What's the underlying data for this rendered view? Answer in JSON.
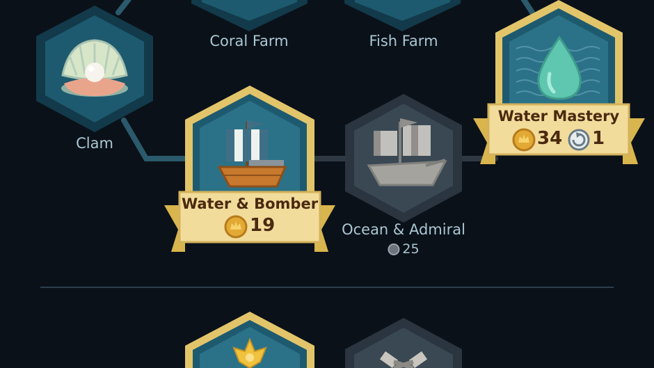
{
  "tree": {
    "top_row": {
      "coral_farm": {
        "label": "Coral Farm"
      },
      "fish_farm": {
        "label": "Fish Farm"
      }
    },
    "clam": {
      "label": "Clam",
      "icon": "clam-pearl-icon"
    },
    "water_mastery": {
      "label": "Water Mastery",
      "coin_cost": "34",
      "turns": "1",
      "icon": "water-drop-icon",
      "state": "available"
    },
    "water_bomber": {
      "label": "Water & Bomber",
      "coin_cost": "19",
      "icon": "sailing-ship-icon",
      "state": "available"
    },
    "ocean_admiral": {
      "label": "Ocean & Admiral",
      "coin_cost": "25",
      "icon": "galleon-icon",
      "state": "locked"
    },
    "next_row": {
      "left_icon": "golden-crown-icon",
      "right_icon": "crossed-tools-icon"
    }
  },
  "colors": {
    "background": "#0b1119",
    "teal_hex": "#1e5a6f",
    "teal_inner": "#2b7288",
    "locked_hex": "#3a4854",
    "gold_border": "#e2c56a",
    "banner": "#f2dc9b",
    "banner_text": "#4a2a10",
    "label_text": "#a9c8d3"
  }
}
